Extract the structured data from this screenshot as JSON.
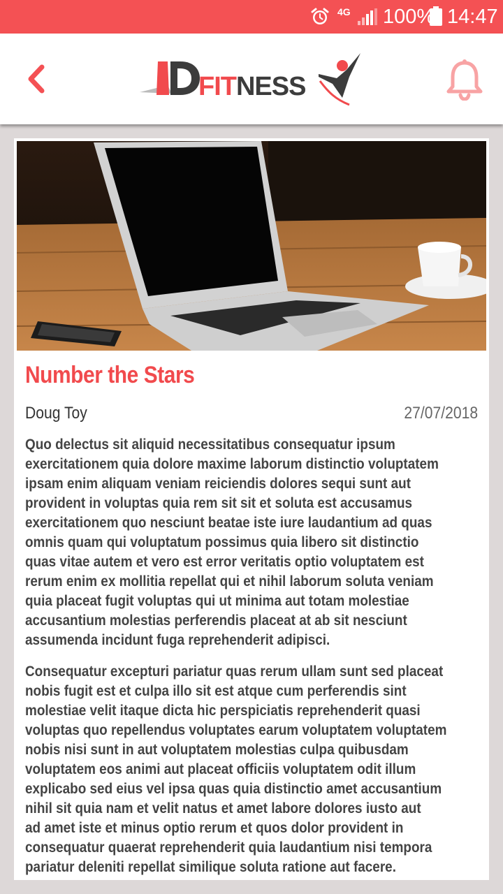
{
  "status_bar": {
    "network": "4G",
    "battery": "100%",
    "time": "14:47",
    "icons": [
      "alarm-icon",
      "signal-icon",
      "battery-icon"
    ]
  },
  "header": {
    "logo_text": "DFITNESS",
    "icons": [
      "chevron-left-icon",
      "bell-icon"
    ],
    "colors": {
      "accent": "#f45154",
      "icon_light": "#f8a3a4"
    }
  },
  "article": {
    "title": "Number the Stars",
    "author": "Doug Toy",
    "date": "27/07/2018",
    "paragraphs": [
      [
        "Quo delectus sit aliquid necessitatibus consequatur ipsum",
        "exercitationem quia dolore maxime laborum distinctio voluptatem",
        "ipsam enim aliquam veniam reiciendis dolores sequi sunt aut",
        "provident in voluptas quia rem sit sit et soluta est accusamus",
        "exercitationem quo nesciunt beatae iste iure laudantium ad quas",
        "omnis quam qui voluptatum possimus quia libero sit distinctio",
        "quas vitae autem et vero est error veritatis optio voluptatem est",
        "rerum enim ex mollitia repellat qui et nihil laborum soluta veniam",
        "quia placeat fugit voluptas qui ut minima aut totam molestiae",
        "accusantium molestias perferendis placeat at ab sit nesciunt",
        "assumenda incidunt fuga reprehenderit adipisci."
      ],
      [
        "Consequatur excepturi pariatur quas rerum ullam sunt sed placeat",
        "nobis fugit est et culpa illo sit est atque cum perferendis sint",
        "molestiae velit itaque dicta hic perspiciatis reprehenderit quasi",
        "voluptas quo repellendus voluptates earum voluptatem voluptatem",
        "nobis nisi sunt in aut voluptatem molestias culpa quibusdam",
        "voluptatem eos animi aut placeat officiis voluptatem odit illum",
        "explicabo sed eius vel ipsa quas quia distinctio amet accusantium",
        "nihil sit quia nam et velit natus et amet labore dolores iusto aut",
        "ad amet iste et minus optio rerum et quos dolor provident in",
        "consequatur quaerat reprehenderit quia laudantium nisi tempora",
        "pariatur deleniti repellat similique soluta ratione aut facere."
      ]
    ]
  }
}
